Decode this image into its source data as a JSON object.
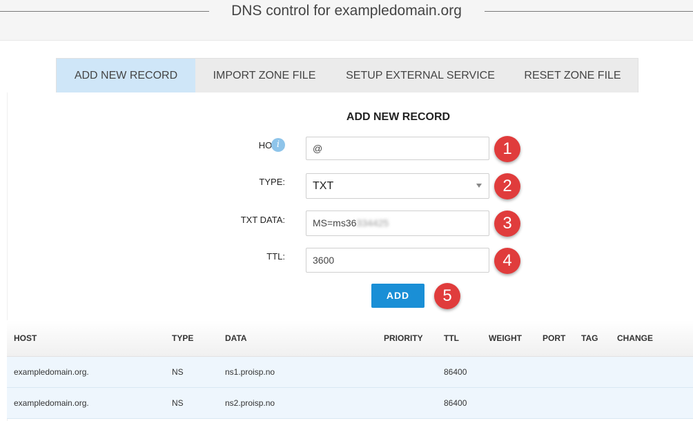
{
  "page": {
    "title": "DNS control for exampledomain.org"
  },
  "tabs": [
    {
      "label": "ADD NEW RECORD",
      "active": true
    },
    {
      "label": "IMPORT ZONE FILE",
      "active": false
    },
    {
      "label": "SETUP EXTERNAL SERVICE",
      "active": false
    },
    {
      "label": "RESET ZONE FILE",
      "active": false
    }
  ],
  "form": {
    "title": "ADD NEW RECORD",
    "host_label": "HOST:",
    "host_value": "@",
    "type_label": "TYPE:",
    "type_value": "TXT",
    "txt_label": "TXT DATA:",
    "txt_value_visible": "MS=ms36",
    "txt_value_blurred": "334425",
    "ttl_label": "TTL:",
    "ttl_value": "3600",
    "add_label": "ADD",
    "step_numbers": [
      "1",
      "2",
      "3",
      "4",
      "5"
    ]
  },
  "table": {
    "headers": [
      "HOST",
      "TYPE",
      "DATA",
      "PRIORITY",
      "TTL",
      "WEIGHT",
      "PORT",
      "TAG",
      "CHANGE"
    ],
    "rows": [
      [
        "exampledomain.org.",
        "NS",
        "ns1.proisp.no",
        "",
        "86400",
        "",
        "",
        "",
        ""
      ],
      [
        "exampledomain.org.",
        "NS",
        "ns2.proisp.no",
        "",
        "86400",
        "",
        "",
        "",
        ""
      ]
    ]
  },
  "colors": {
    "active_tab": "#cfe6f8",
    "add_button": "#1a8fd6",
    "step_badge": "#e03c3c",
    "row_bg": "#eef6fd"
  }
}
